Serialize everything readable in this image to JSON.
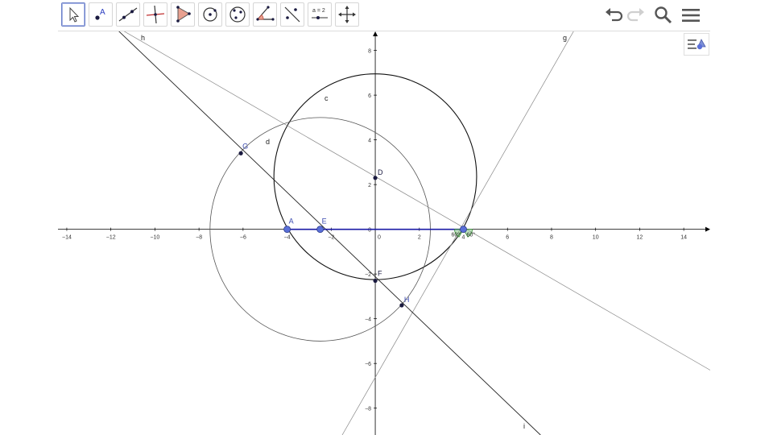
{
  "toolbar": {
    "tools": [
      {
        "id": "move",
        "icon": "pointer-arrow-icon"
      },
      {
        "id": "point",
        "icon": "point-icon",
        "glyph": "A"
      },
      {
        "id": "line",
        "icon": "line-through-points-icon"
      },
      {
        "id": "perpendicular",
        "icon": "perpendicular-line-icon"
      },
      {
        "id": "polygon",
        "icon": "polygon-icon"
      },
      {
        "id": "circle-center-point",
        "icon": "circle-center-point-icon"
      },
      {
        "id": "circle-three-points",
        "icon": "circle-three-points-icon"
      },
      {
        "id": "angle",
        "icon": "angle-icon"
      },
      {
        "id": "reflect",
        "icon": "reflect-about-line-icon"
      },
      {
        "id": "slider",
        "icon": "slider-icon",
        "glyph": "a = 2"
      },
      {
        "id": "move-graphics",
        "icon": "move-graphics-view-icon"
      }
    ],
    "actions": [
      "undo-icon",
      "redo-icon",
      "search-icon",
      "menu-icon"
    ]
  },
  "graphics": {
    "x_ticks": [
      "−14",
      "−12",
      "−10",
      "−8",
      "−6",
      "−4",
      "−2",
      "0",
      "2",
      "4",
      "6",
      "8",
      "10",
      "12",
      "14"
    ],
    "y_ticks": [
      "8",
      "6",
      "4",
      "2",
      "0",
      "−2",
      "−4",
      "−6",
      "−8"
    ],
    "xlim": [
      -14.4,
      15.2
    ],
    "ylim": [
      -9.2,
      8.85
    ],
    "origin_label": "0",
    "colors": {
      "axis": "#000000",
      "segment": "#1a1aa6",
      "point_blue": "#5a6fd8",
      "point_dark": "#1a1a40",
      "angle": "#2e8b2e",
      "thin_line": "#888888",
      "circle": "#333333"
    },
    "objects": {
      "labels": {
        "h": "h",
        "g": "g",
        "c": "c",
        "d": "d",
        "i": "i",
        "A": "A",
        "E": "E",
        "D": "D",
        "F": "F",
        "G": "G",
        "H": "H",
        "angle1": "60°",
        "angle2": "60°"
      },
      "points": {
        "A": {
          "x": -4.0,
          "y": 0.0
        },
        "E": {
          "x": -2.5,
          "y": 0.0
        },
        "B": {
          "x": 4.0,
          "y": 0.0
        },
        "D": {
          "x": 0.0,
          "y": 2.3
        },
        "F": {
          "x": 0.0,
          "y": -2.3
        },
        "G": {
          "x": -6.1,
          "y": 3.4
        },
        "H": {
          "x": 1.2,
          "y": -3.4
        }
      },
      "circles": {
        "c": {
          "cx": 0.0,
          "cy": 2.35,
          "r": 4.6
        },
        "d": {
          "cx": -2.5,
          "cy": 0.0,
          "r": 5.0
        }
      },
      "lines": {
        "h": {
          "p1": [
            -12.0,
            9.2
          ],
          "p2": [
            15.2,
            -6.3
          ]
        },
        "g": {
          "p1": [
            -1.5,
            -9.2
          ],
          "p2": [
            9.2,
            9.2
          ]
        },
        "i": {
          "p1": [
            -12.0,
            9.2
          ],
          "p2": [
            7.5,
            -9.2
          ]
        }
      },
      "segment_AB": {
        "from": "A",
        "to": "B"
      }
    }
  }
}
